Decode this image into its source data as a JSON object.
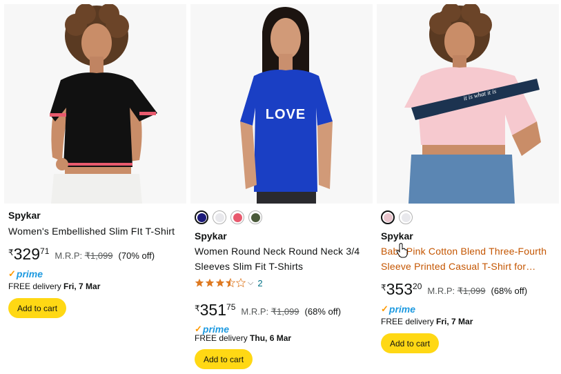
{
  "currency_symbol": "₹",
  "colors": {
    "prime_blue": "#1e9ae0",
    "prime_check": "#ff9900",
    "cart_button": "#ffd814",
    "link_orange": "#c45500",
    "rating_star": "#de7921",
    "review_link": "#007185"
  },
  "products": [
    {
      "brand": "Spykar",
      "title": "Women's Embellished Slim FIt T-Shirt",
      "price_whole": "329",
      "price_fraction": "71",
      "mrp_label": "M.R.P:",
      "mrp_value": "₹1,099",
      "discount": "(70% off)",
      "prime_label": "prime",
      "delivery_prefix": "FREE delivery",
      "delivery_date": "Fri, 7 Mar",
      "add_to_cart": "Add to cart",
      "image_icon": "black-crop-top-photo"
    },
    {
      "brand": "Spykar",
      "title_line1": "Women Round Neck Round Neck 3/4",
      "title_line2": "Sleeves Slim Fit T-Shirts",
      "swatches": [
        "#1c1a7a",
        "#e8e8ec",
        "#e85a6e",
        "#4a5a3a"
      ],
      "rating": 3.5,
      "review_count": "2",
      "price_whole": "351",
      "price_fraction": "75",
      "mrp_label": "M.R.P:",
      "mrp_value": "₹1,099",
      "discount": "(68% off)",
      "prime_label": "prime",
      "delivery_prefix": "FREE delivery",
      "delivery_date": "Thu, 6 Mar",
      "add_to_cart": "Add to cart",
      "shirt_print": "LOVE",
      "image_icon": "blue-love-tshirt-photo"
    },
    {
      "brand": "Spykar",
      "title_line1": "Baby Pink Cotton Blend Three-Fourth",
      "title_line2": "Sleeve Printed Casual T-Shirt for…",
      "swatches": [
        "#e8c4cc",
        "#e8e8ec"
      ],
      "price_whole": "353",
      "price_fraction": "20",
      "mrp_label": "M.R.P:",
      "mrp_value": "₹1,099",
      "discount": "(68% off)",
      "prime_label": "prime",
      "delivery_prefix": "FREE delivery",
      "delivery_date": "Fri, 7 Mar",
      "add_to_cart": "Add to cart",
      "shirt_print": "it is what it is",
      "image_icon": "pink-crop-tshirt-photo"
    }
  ]
}
